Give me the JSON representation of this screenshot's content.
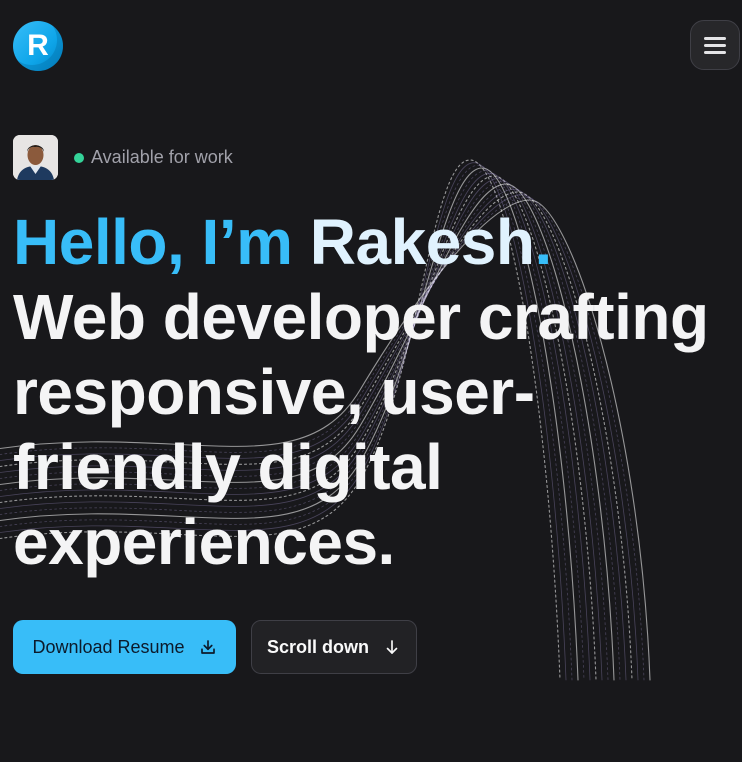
{
  "header": {
    "logo_letter": "R",
    "menu_icon": "hamburger-icon"
  },
  "profile": {
    "status_text": "Available for work",
    "status_color": "#34d399"
  },
  "hero": {
    "greeting": "Hello, I’m ",
    "name": "Rakesh",
    "period": ".",
    "tagline": "Web developer crafting responsive, user-friendly digital experiences."
  },
  "actions": {
    "download_label": "Download Resume",
    "download_icon": "download-icon",
    "scroll_label": "Scroll down",
    "scroll_icon": "arrow-down-icon"
  },
  "colors": {
    "background": "#18181b",
    "accent": "#38bdf8",
    "secondary_button": "#222225"
  }
}
